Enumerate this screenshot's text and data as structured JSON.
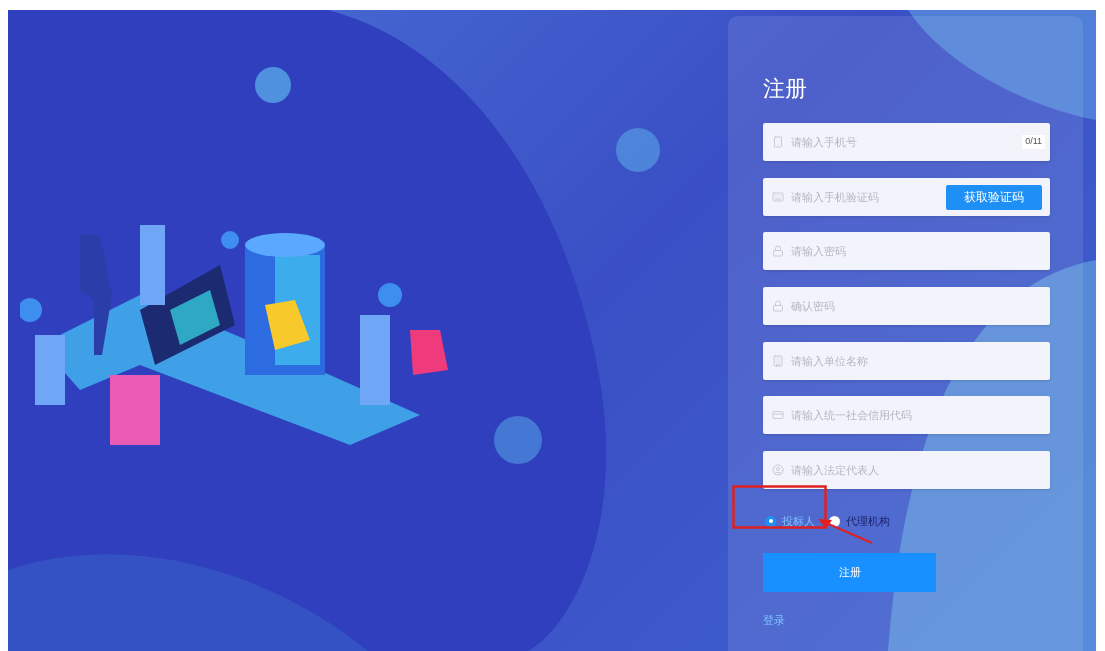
{
  "form": {
    "title": "注册",
    "fields": [
      {
        "kind": "counter",
        "placeholder": "请输入手机号",
        "counter": "0/11"
      },
      {
        "kind": "code",
        "placeholder": "请输入手机验证码",
        "button": "获取验证码"
      },
      {
        "kind": "plain",
        "placeholder": "请输入密码"
      },
      {
        "kind": "plain",
        "placeholder": "确认密码"
      },
      {
        "kind": "plain",
        "placeholder": "请输入单位名称"
      },
      {
        "kind": "plain",
        "placeholder": "请输入统一社会信用代码"
      },
      {
        "kind": "plain",
        "placeholder": "请输入法定代表人"
      }
    ],
    "roles": [
      {
        "label": "投标人",
        "selected": true
      },
      {
        "label": "代理机构",
        "selected": false
      }
    ],
    "submit": "注册",
    "login_link": "登录"
  }
}
